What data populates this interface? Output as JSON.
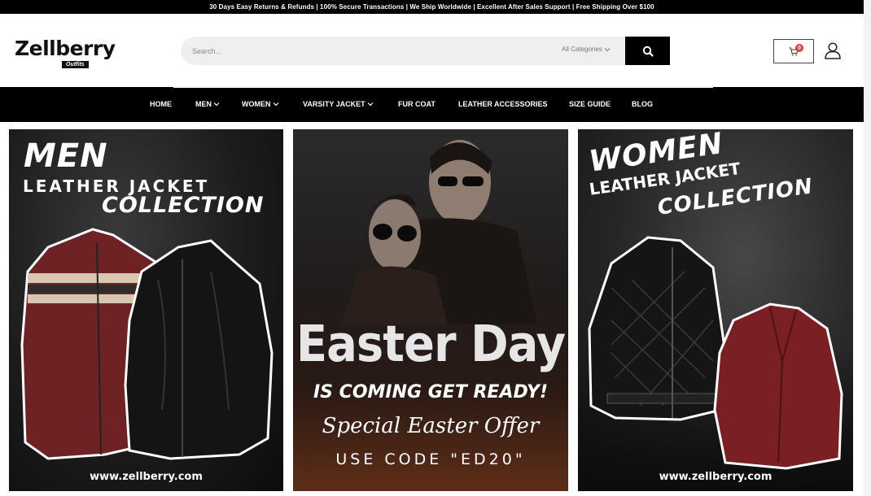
{
  "topbar": {
    "text": "30 Days Easy Returns & Refunds | 100% Secure Transactions | We Ship Worldwide | Excellent After Sales Support | Free Shipping Over $100"
  },
  "logo": {
    "name": "Zellberry",
    "sub": "Outfits"
  },
  "search": {
    "placeholder": "Search...",
    "category": "All Categories"
  },
  "cart": {
    "count": "0"
  },
  "nav": {
    "items": [
      {
        "label": "HOME"
      },
      {
        "label": "MEN"
      },
      {
        "label": "WOMEN"
      },
      {
        "label": "VARSITY JACKET"
      },
      {
        "label": "FUR COAT"
      },
      {
        "label": "LEATHER ACCESSORIES"
      },
      {
        "label": "SIZE GUIDE"
      },
      {
        "label": "BLOG"
      }
    ]
  },
  "banners": {
    "men": {
      "line1": "MEN",
      "line2": "LEATHER JACKET",
      "line3": "COLLECTION",
      "url": "www.zellberry.com"
    },
    "easter": {
      "title": "Easter Day",
      "subtitle": "IS COMING GET READY!",
      "offer": "Special Easter Offer",
      "code": "USE CODE \"ED20\""
    },
    "women": {
      "line1": "WOMEN",
      "line2": "LEATHER JACKET",
      "line3": "COLLECTION",
      "url": "www.zellberry.com"
    }
  },
  "colors": {
    "accent": "#000000",
    "badge": "#e23c3c",
    "maroon": "#7a1f23"
  }
}
